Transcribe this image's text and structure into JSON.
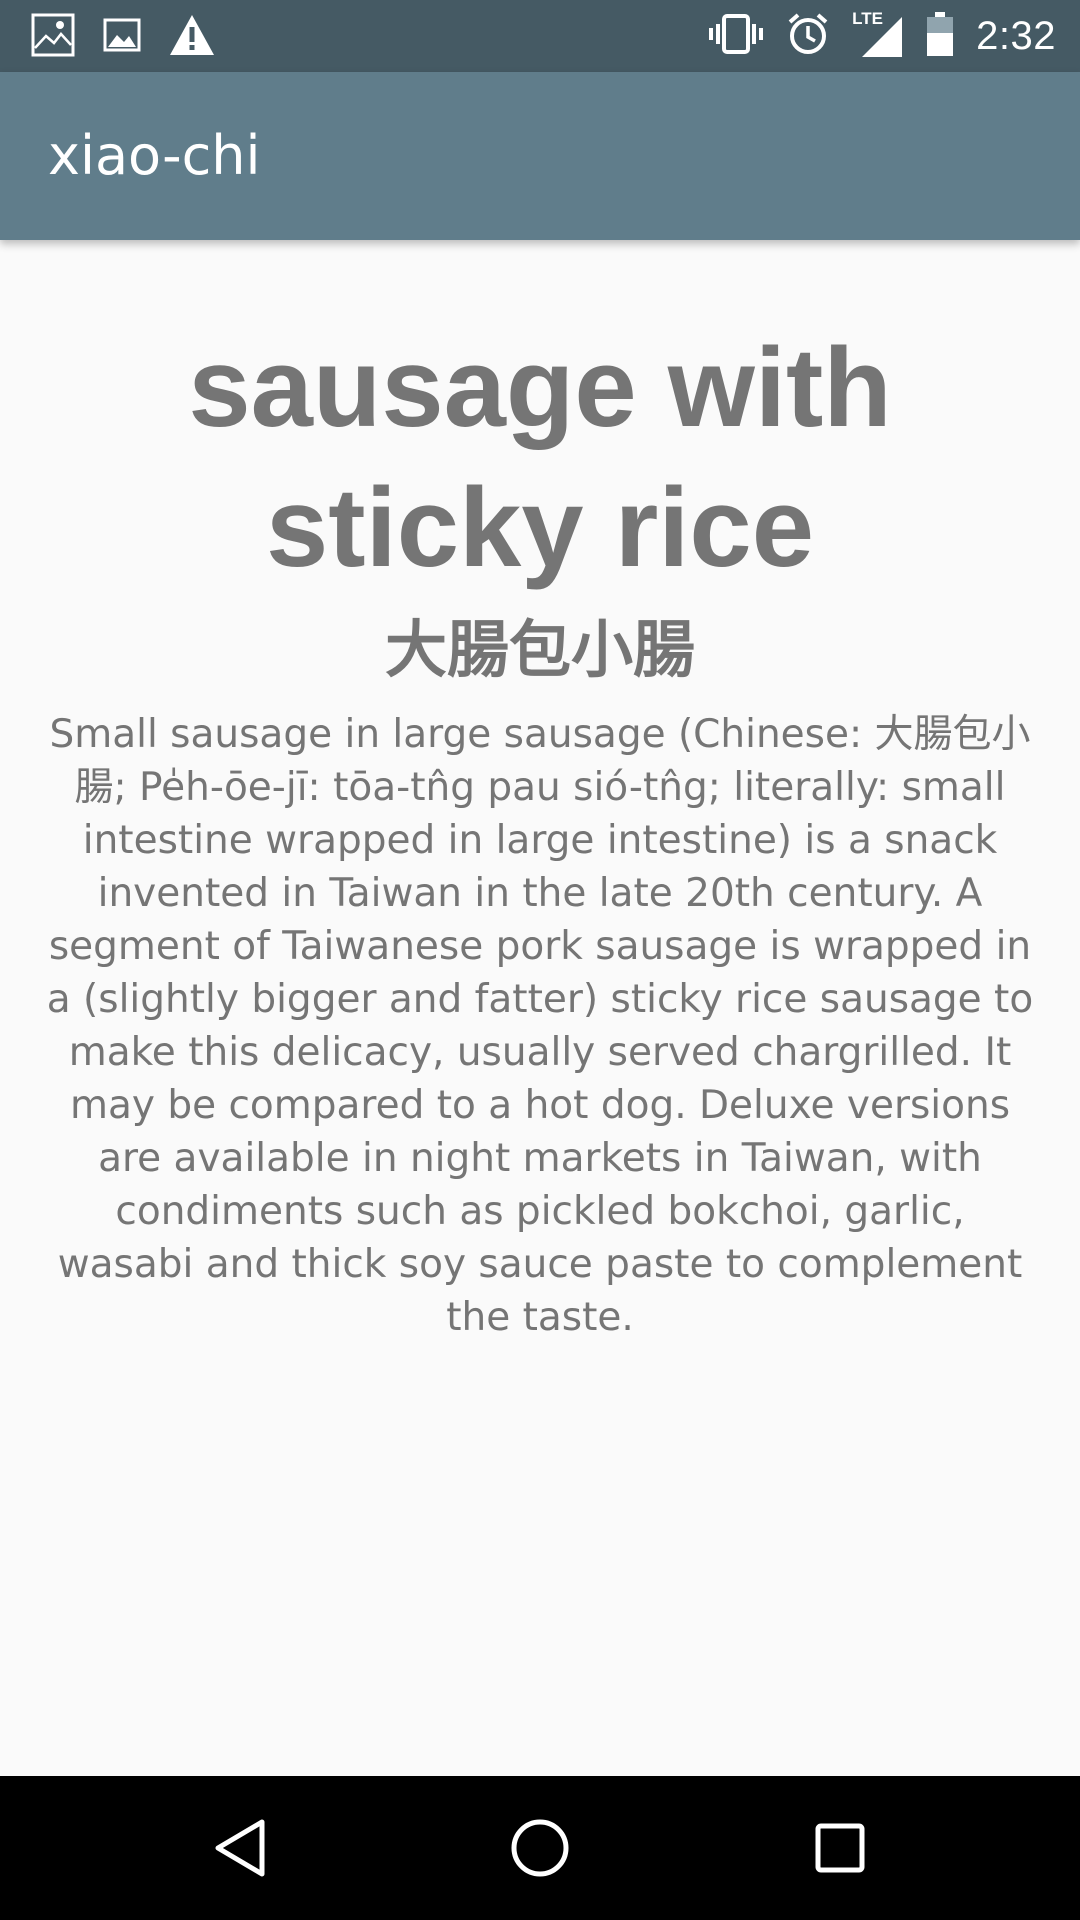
{
  "status_bar": {
    "time": "2:32",
    "network_label": "LTE",
    "icons": [
      "photo-notification-icon",
      "image-notification-icon",
      "warning-icon",
      "vibrate-icon",
      "alarm-icon",
      "signal-icon",
      "battery-icon"
    ]
  },
  "app_bar": {
    "title": "xiao-chi"
  },
  "dish": {
    "name": "sausage with sticky rice",
    "chinese_name": "大腸包小腸",
    "description": "Small sausage in large sausage (Chinese: 大腸包小腸; Pe̍h-ōe-jī: tōa-tn̂g pau sió-tn̂g; literally: small intestine wrapped in large intestine) is a snack invented in Taiwan in the late 20th century. A segment of Taiwanese pork sausage is wrapped in a (slightly bigger and fatter) sticky rice sausage to make this delicacy, usually served chargrilled. It may be compared to a hot dog. Deluxe versions are available in night markets in Taiwan, with condiments such as pickled bokchoi, garlic, wasabi and thick soy sauce paste to complement the taste."
  },
  "nav_bar": {
    "buttons": [
      "back-icon",
      "home-icon",
      "recents-icon"
    ]
  },
  "colors": {
    "status_bar": "#455a64",
    "app_bar": "#607d8b",
    "text": "#757575",
    "background": "#fafafa"
  }
}
